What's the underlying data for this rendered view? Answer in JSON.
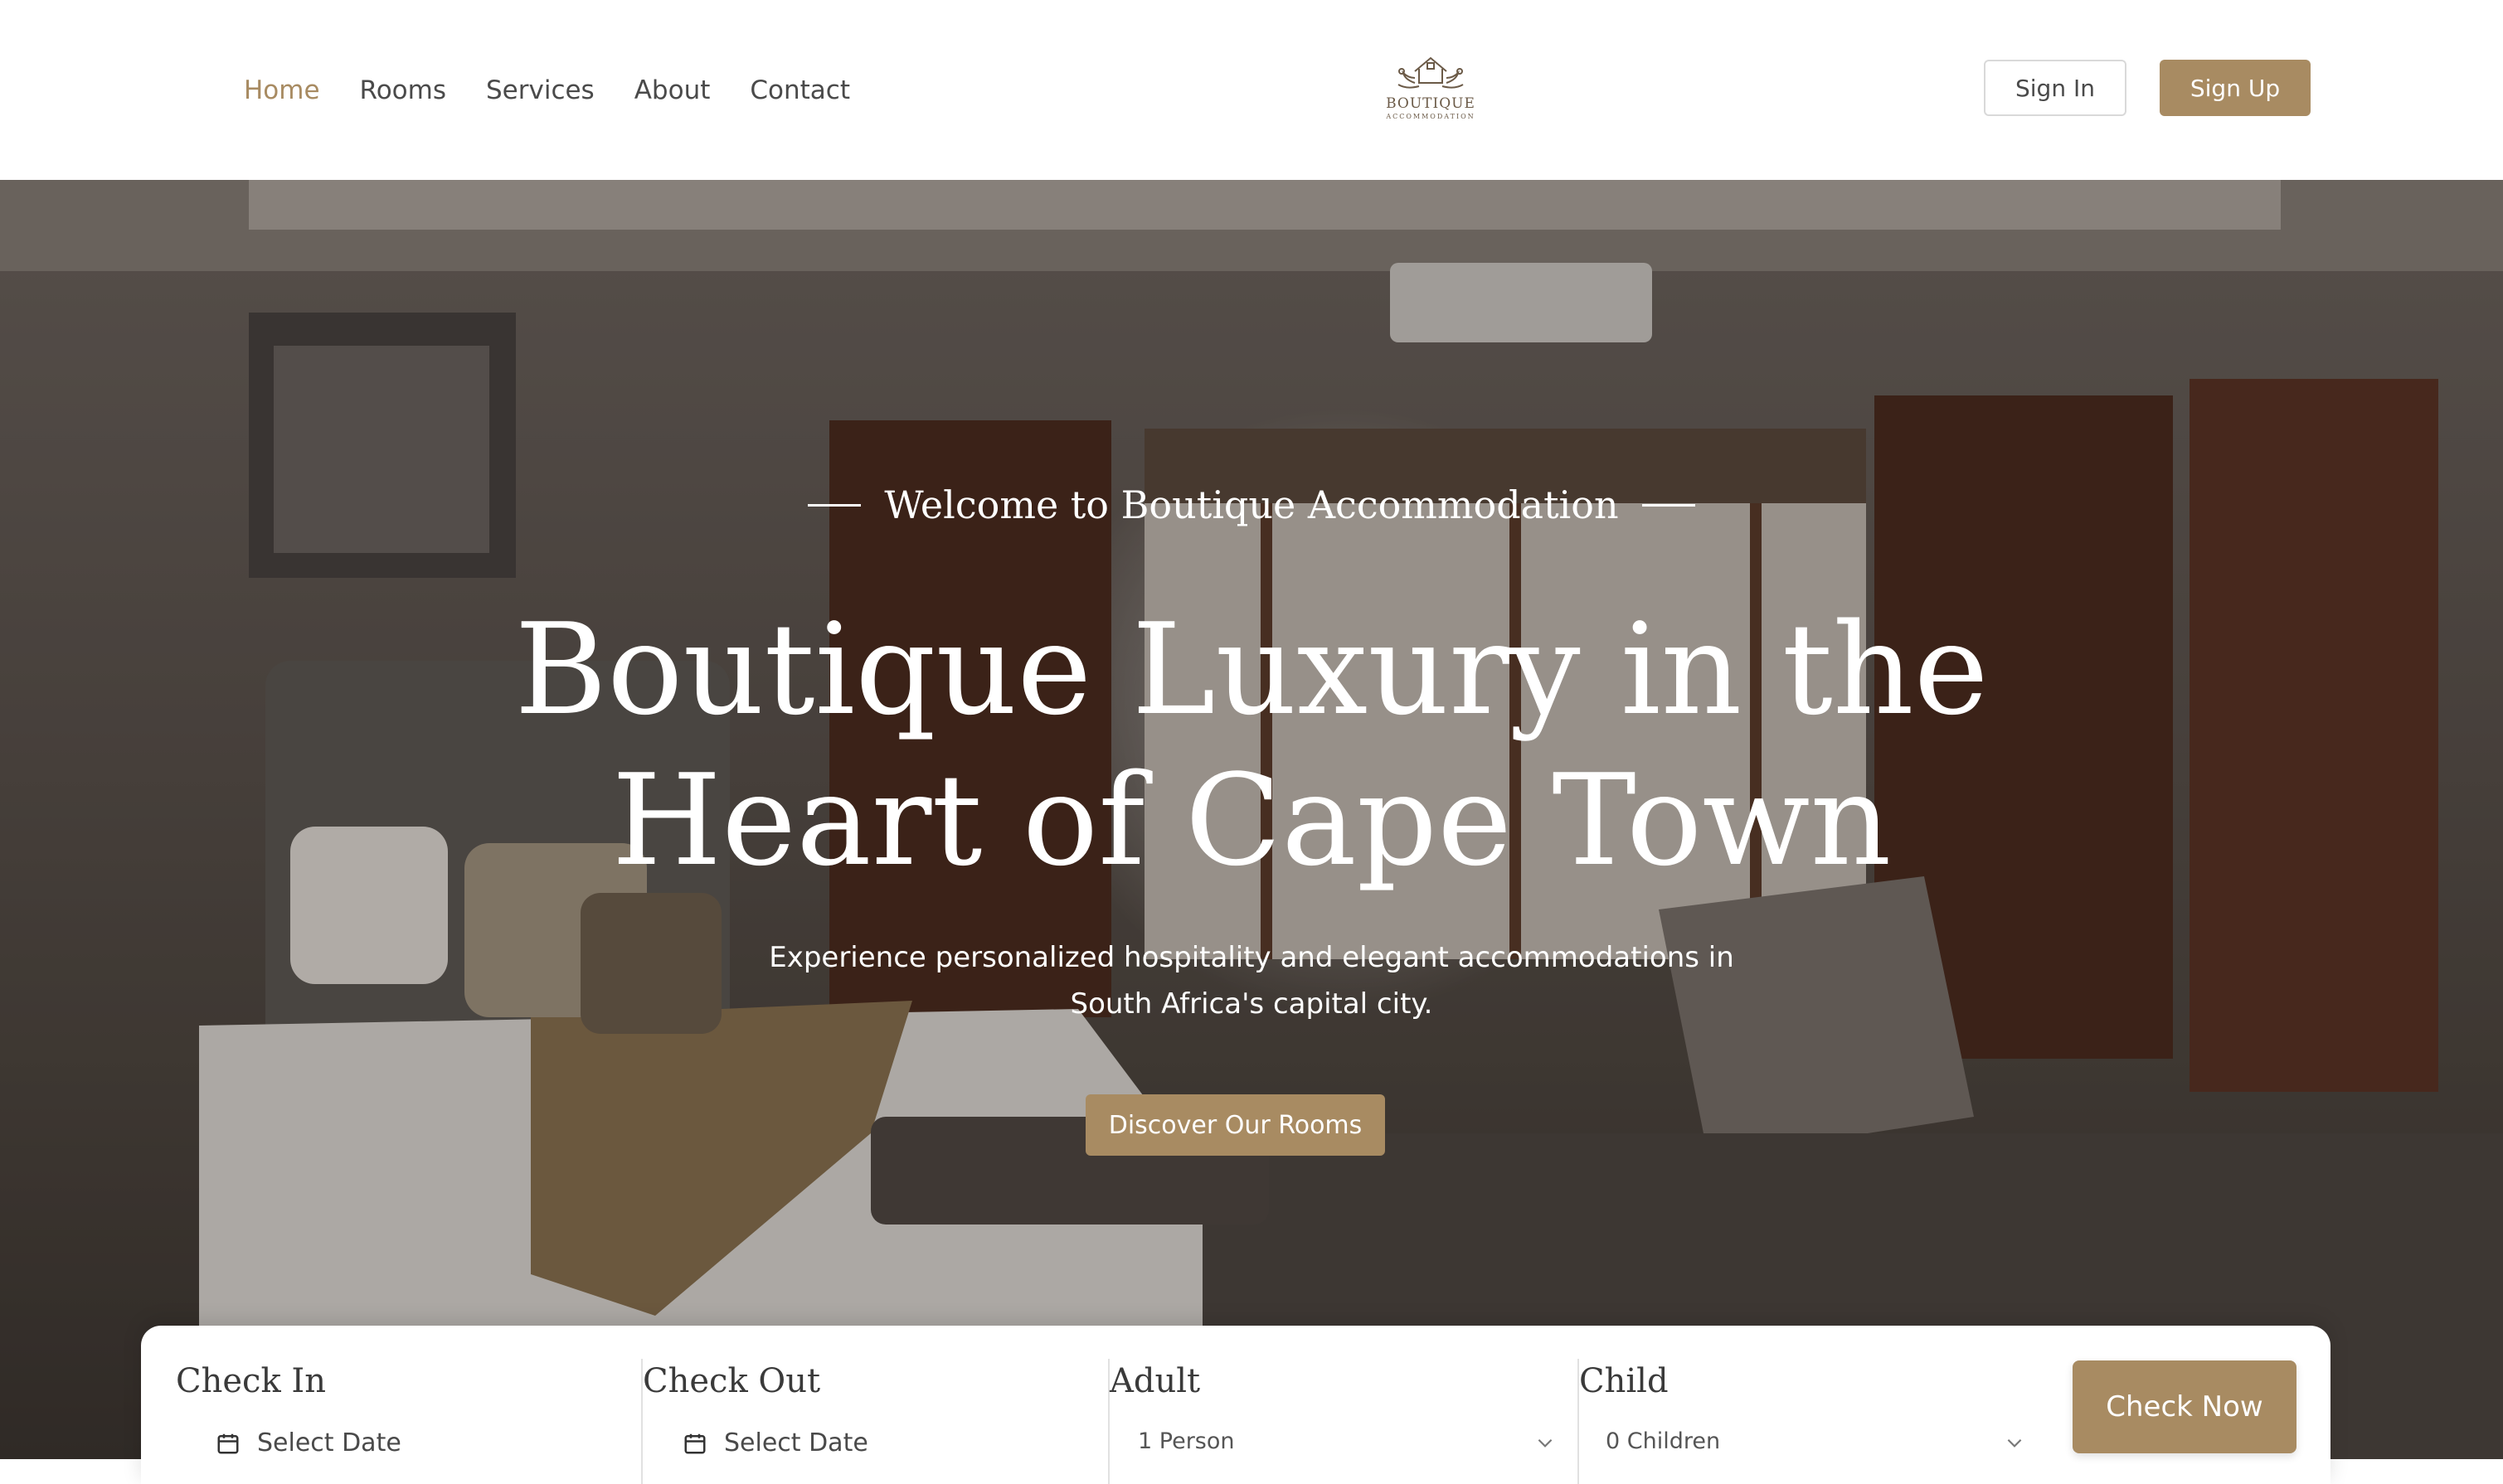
{
  "brand": {
    "name": "BOUTIQUE",
    "subtitle": "ACCOMMODATION",
    "accent_color": "#a88b62"
  },
  "nav": {
    "items": [
      {
        "label": "Home",
        "active": true
      },
      {
        "label": "Rooms",
        "active": false
      },
      {
        "label": "Services",
        "active": false
      },
      {
        "label": "About",
        "active": false
      },
      {
        "label": "Contact",
        "active": false
      }
    ]
  },
  "auth": {
    "signin_label": "Sign In",
    "signup_label": "Sign Up"
  },
  "hero": {
    "eyebrow": "Welcome to Boutique Accommodation",
    "title_line1": "Boutique Luxury in the",
    "title_line2": "Heart of Cape Town",
    "subtitle_line1": "Experience personalized hospitality and elegant accommodations in",
    "subtitle_line2": "South Africa's capital city.",
    "cta_label": "Discover Our Rooms",
    "background_icon": "hotel-bedroom-photo"
  },
  "booking": {
    "check_in": {
      "label": "Check In",
      "value": "Select Date",
      "icon": "calendar-icon"
    },
    "check_out": {
      "label": "Check Out",
      "value": "Select Date",
      "icon": "calendar-icon"
    },
    "adult": {
      "label": "Adult",
      "value": "1 Person",
      "icon": "chevron-down-icon"
    },
    "child": {
      "label": "Child",
      "value": "0 Children",
      "icon": "chevron-down-icon"
    },
    "submit_label": "Check Now"
  }
}
